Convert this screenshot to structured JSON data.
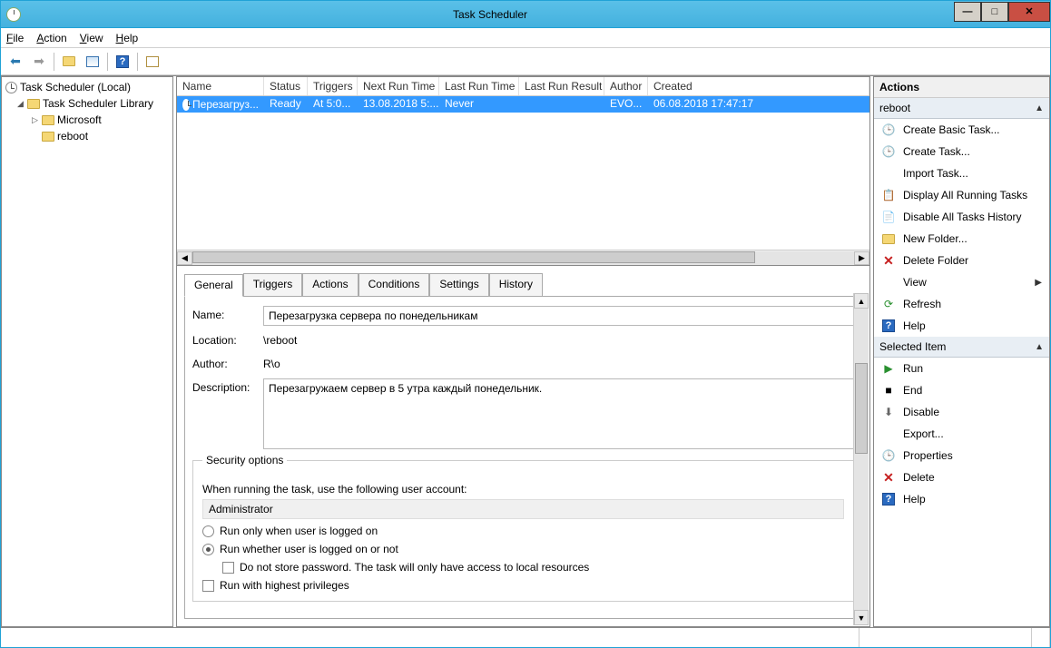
{
  "window": {
    "title": "Task Scheduler"
  },
  "menu": {
    "file": "File",
    "action": "Action",
    "view": "View",
    "help": "Help"
  },
  "tree": {
    "root": "Task Scheduler (Local)",
    "library": "Task Scheduler Library",
    "microsoft": "Microsoft",
    "reboot": "reboot"
  },
  "tasklist": {
    "cols": {
      "name": "Name",
      "status": "Status",
      "triggers": "Triggers",
      "nextrun": "Next Run Time",
      "lastrun": "Last Run Time",
      "lastresult": "Last Run Result",
      "author": "Author",
      "created": "Created"
    },
    "row": {
      "name": "Перезагруз...",
      "status": "Ready",
      "triggers": "At 5:0...",
      "nextrun": "13.08.2018 5:...",
      "lastrun": "Never",
      "lastresult": "",
      "author": "EVO...",
      "created": "06.08.2018 17:47:17"
    }
  },
  "tabs": {
    "general": "General",
    "triggers": "Triggers",
    "actions": "Actions",
    "conditions": "Conditions",
    "settings": "Settings",
    "history": "History"
  },
  "general": {
    "name_label": "Name:",
    "name": "Перезагрузка сервера по понедельникам",
    "location_label": "Location:",
    "location": "\\reboot",
    "author_label": "Author:",
    "author": "R\\o",
    "description_label": "Description:",
    "description": "Перезагружаем сервер в 5 утра каждый понедельник.",
    "security_legend": "Security options",
    "security_text": "When running the task, use the following user account:",
    "account": "Administrator",
    "radio_loggedon": "Run only when user is logged on",
    "radio_whether": "Run whether user is logged on or not",
    "check_nopass": "Do not store password.  The task will only have access to local resources",
    "check_highest": "Run with highest privileges"
  },
  "actions": {
    "title": "Actions",
    "header1": "reboot",
    "items1": {
      "create_basic": "Create Basic Task...",
      "create": "Create Task...",
      "import": "Import Task...",
      "display_running": "Display All Running Tasks",
      "disable_history": "Disable All Tasks History",
      "new_folder": "New Folder...",
      "delete_folder": "Delete Folder",
      "view": "View",
      "refresh": "Refresh",
      "help": "Help"
    },
    "header2": "Selected Item",
    "items2": {
      "run": "Run",
      "end": "End",
      "disable": "Disable",
      "export": "Export...",
      "properties": "Properties",
      "delete": "Delete",
      "help": "Help"
    }
  }
}
